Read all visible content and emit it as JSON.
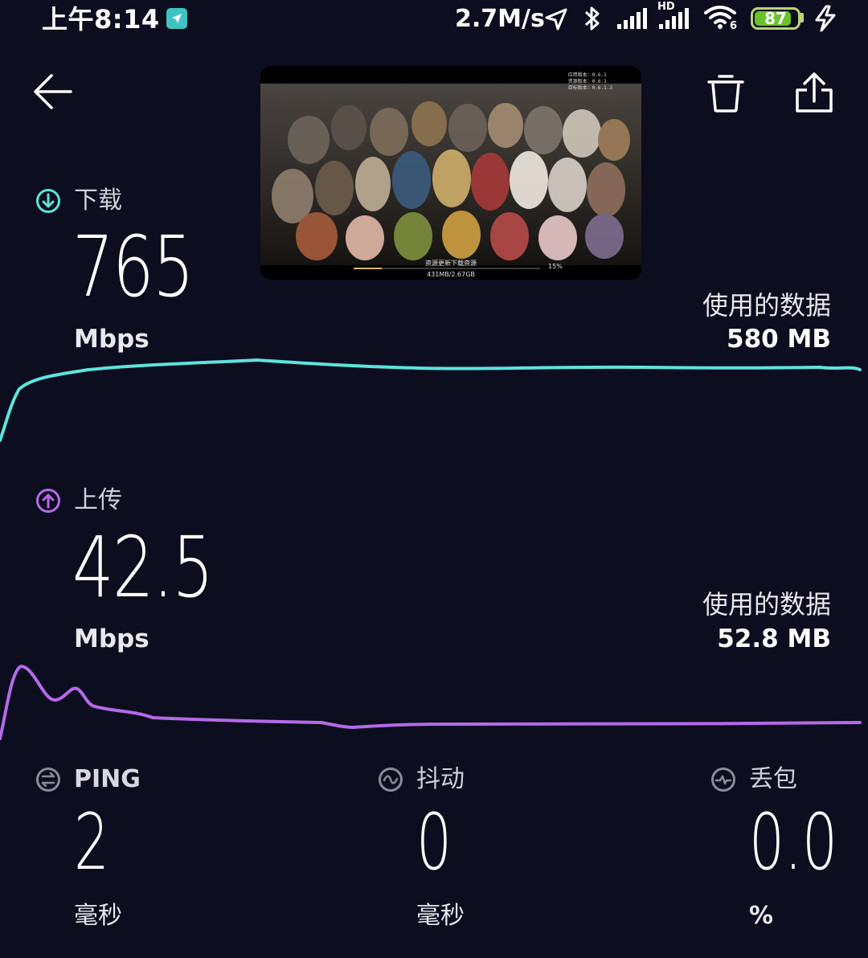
{
  "status_bar": {
    "time": "上午8:14",
    "net_speed": "2.7M/s",
    "battery_level": "87",
    "battery_fraction": 0.87,
    "icons": [
      "navigation-app-icon",
      "location-arrow-icon",
      "bluetooth-icon",
      "signal-icon",
      "hd-signal-icon",
      "wifi-icon",
      "charging-icon"
    ],
    "signal_hd_label": "HD",
    "wifi_label": "6"
  },
  "toolbar": {
    "icons": [
      "back-arrow-icon",
      "trash-icon",
      "share-icon"
    ]
  },
  "pip_video": {
    "overlay_lines": [
      "应用版本：0.6.1",
      "资源版本：0.6.1",
      "目标版本：0.6.1.3"
    ],
    "progress_label": "资源更新下载资源",
    "progress_percent_text": "15%",
    "progress_fraction": 0.15,
    "size_text": "431MB/2.67GB"
  },
  "download": {
    "label": "下载",
    "value": "765",
    "unit": "Mbps",
    "data_used_label": "使用的数据",
    "data_used_value": "580 MB",
    "color": "#5ce4dc"
  },
  "upload": {
    "label": "上传",
    "value": "42.5",
    "unit": "Mbps",
    "data_used_label": "使用的数据",
    "data_used_value": "52.8 MB",
    "color": "#b56ae8"
  },
  "ping": {
    "label": "PING",
    "value": "2",
    "unit": "毫秒"
  },
  "jitter": {
    "label": "抖动",
    "value": "0",
    "unit": "毫秒"
  },
  "loss": {
    "label": "丢包",
    "value": "0.0",
    "unit": "%"
  },
  "accent_icon_color": "#8a8b98"
}
